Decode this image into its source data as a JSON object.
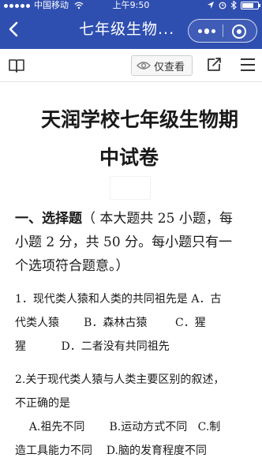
{
  "status_bar": {
    "carrier": "中国移动",
    "time": "上午9:50"
  },
  "nav": {
    "title": "七年级生物..."
  },
  "toolbar": {
    "view_only_label": "仅查看"
  },
  "document": {
    "title_line1": "天润学校七年级生物期",
    "title_line2": "中试卷",
    "section": {
      "heading": "一、选择题",
      "desc_line1": "（ 本大题共 25 小题，每",
      "line2": "小题 2 分，共 50 分。每小题只有一",
      "line3": "个选项符合题意。）"
    },
    "q1": {
      "line1": "1．现代类人猿和人类的共同祖先是 A．古",
      "line2": "代类人猿       B．森林古猿        C．猩",
      "line3": "猩          D．二者没有共同祖先"
    },
    "q2": {
      "line1": "2.关于现代类人猿与人类主要区别的叙述，",
      "line2": "不正确的是",
      "line3": "    A.祖先不同       B.运动方式不同   C.制",
      "line4": "造工具能力不同    D.脑的发育程度不同"
    }
  }
}
